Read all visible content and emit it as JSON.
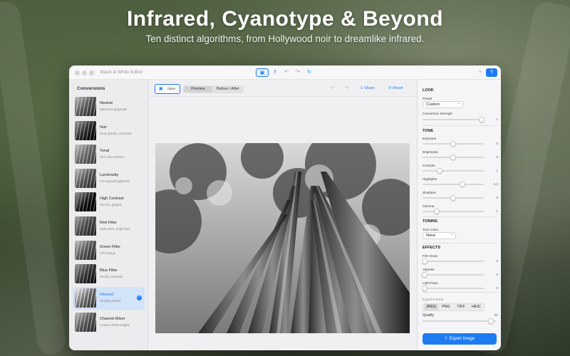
{
  "hero": {
    "title": "Infrared, Cyanotype & Beyond",
    "subtitle": "Ten distinct algorithms, from Hollywood noir to dreamlike infrared."
  },
  "window": {
    "title": "Black & White Editor",
    "toolbar_icons": [
      "image-icon",
      "share-icon",
      "undo-icon",
      "redo-icon",
      "rotate-icon"
    ],
    "right_icons": [
      "plus-icon",
      "export-icon"
    ]
  },
  "sidebar": {
    "heading": "Conversions",
    "items": [
      {
        "name": "Neutral",
        "desc": "Balanced grayscale",
        "selected": false
      },
      {
        "name": "Noir",
        "desc": "Deep blacks, cinematic",
        "selected": false
      },
      {
        "name": "Tonal",
        "desc": "Soft, low-contrast",
        "selected": false
      },
      {
        "name": "Luminosity",
        "desc": "Perceptual brightness",
        "selected": false
      },
      {
        "name": "High Contrast",
        "desc": "Punchy, graphic",
        "selected": false
      },
      {
        "name": "Red Filter",
        "desc": "Dark skies, bright skin",
        "selected": false
      },
      {
        "name": "Green Filter",
        "desc": "Lifts foliage",
        "selected": false
      },
      {
        "name": "Blue Filter",
        "desc": "Moody, dramatic",
        "selected": false
      },
      {
        "name": "Infrared",
        "desc": "Glowing whites",
        "selected": true
      },
      {
        "name": "Channel Mixer",
        "desc": "Custom RGB weights",
        "selected": false
      }
    ]
  },
  "center": {
    "open_label": "Open",
    "view_modes": [
      "Preview",
      "Before / After"
    ],
    "share_label": "Share",
    "reset_label": "Reset"
  },
  "panel": {
    "look": {
      "heading": "LOOK",
      "preset_label": "Preset",
      "preset_value": "Custom",
      "strength_label": "Conversion Strength",
      "strength_value": 1,
      "strength_display": "1"
    },
    "tone": {
      "heading": "TONE",
      "sliders": [
        {
          "label": "Exposure",
          "display": "0",
          "fraction": 0.5
        },
        {
          "label": "Brightness",
          "display": "0",
          "fraction": 0.5
        },
        {
          "label": "Contrast",
          "display": "1",
          "fraction": 0.28
        },
        {
          "label": "Highlights",
          "display": "0.3",
          "fraction": 0.65
        },
        {
          "label": "Shadows",
          "display": "0",
          "fraction": 0.5
        },
        {
          "label": "Gamma",
          "display": "1",
          "fraction": 0.23
        }
      ]
    },
    "toning": {
      "heading": "TONING",
      "color_label": "Tone Color",
      "color_value": "None"
    },
    "effects": {
      "heading": "EFFECTS",
      "sliders": [
        {
          "label": "Film Grain",
          "display": "0",
          "fraction": 0.0
        },
        {
          "label": "Vignette",
          "display": "0",
          "fraction": 0.0
        },
        {
          "label": "Light Rays",
          "display": "0",
          "fraction": 0.0
        }
      ]
    },
    "export": {
      "format_label": "Export Format",
      "formats": [
        "JPEG",
        "PNG",
        "TIFF",
        "HEIC"
      ],
      "selected_format": "JPEG",
      "quality_label": "Quality",
      "quality_display": "92",
      "quality_fraction": 0.92,
      "button_label": "Export Image"
    }
  },
  "colors": {
    "accent": "#1e7cf2",
    "selected_row": "#d2e3fa"
  }
}
